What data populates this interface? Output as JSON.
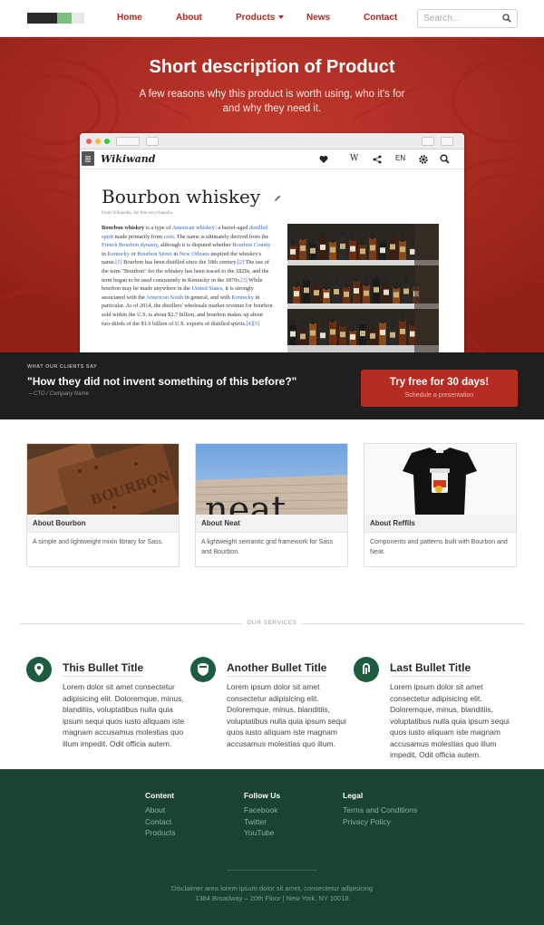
{
  "nav": {
    "links": [
      "Home",
      "About",
      "Products",
      "News",
      "Contact"
    ],
    "search_placeholder": "Search..."
  },
  "hero": {
    "title": "Short description of Product",
    "subtitle": "A few reasons why this product is worth using, who it's for and why they need it."
  },
  "browser": {
    "brand": "Wikiwand",
    "lang": "EN",
    "article_title": "Bourbon whiskey",
    "from_line": "From Wikipedia, the free encyclopedia",
    "body": [
      {
        "t": "Bourbon whiskey",
        "k": "b"
      },
      {
        "t": " is a type of "
      },
      {
        "t": "American whiskey",
        "k": "a"
      },
      {
        "t": ": a barrel-aged "
      },
      {
        "t": "distilled spirit",
        "k": "a"
      },
      {
        "t": " made primarily from "
      },
      {
        "t": "corn",
        "k": "a"
      },
      {
        "t": ". The name is ultimately derived from the "
      },
      {
        "t": "French Bourbon dynasty",
        "k": "a"
      },
      {
        "t": ", although it is disputed whether "
      },
      {
        "t": "Bourbon County",
        "k": "a"
      },
      {
        "t": " in "
      },
      {
        "t": "Kentucky",
        "k": "a"
      },
      {
        "t": " or "
      },
      {
        "t": "Bourbon Street",
        "k": "a"
      },
      {
        "t": " in "
      },
      {
        "t": "New Orleans",
        "k": "a"
      },
      {
        "t": " inspired the whiskey's name."
      },
      {
        "t": "[1]",
        "k": "a"
      },
      {
        "t": " Bourbon has been distilled since the 18th century."
      },
      {
        "t": "[2]",
        "k": "a"
      },
      {
        "t": " The use of the term \"Bourbon\" for the whiskey has been traced to the 1820s, and the term began to be used consistently in Kentucky in the 1870s."
      },
      {
        "t": "[3]",
        "k": "a"
      },
      {
        "t": " While bourbon may be made anywhere in the "
      },
      {
        "t": "United States",
        "k": "a"
      },
      {
        "t": ", it is strongly associated with the "
      },
      {
        "t": "American South",
        "k": "a"
      },
      {
        "t": " in general, and with "
      },
      {
        "t": "Kentucky",
        "k": "a"
      },
      {
        "t": " in particular. As of 2014, the distillers' wholesale market revenue for bourbon sold within the U.S. is about $2.7 billion, and bourbon makes up about two-thirds of the $1.6 billion of U.S. exports of distilled spirits."
      },
      {
        "t": "[4][5]",
        "k": "a"
      }
    ]
  },
  "testimonial": {
    "kicker": "WHAT OUR CLIENTS SAY",
    "quote": "\"How they did not invent something of this before?\"",
    "author": "– CTO / Company Name"
  },
  "cta": {
    "label": "Try free for 30 days!",
    "sub": "Schedule a presentation"
  },
  "cards": [
    {
      "title": "About Bourbon",
      "text": "A simple and lightweight mixin library for Sass."
    },
    {
      "title": "About Neat",
      "text": "A lightweight semantic grid framework for Sass and Bourbon."
    },
    {
      "title": "About Reffils",
      "text": "Components and patterns built with Bourbon and Neat."
    }
  ],
  "services": {
    "label": "OUR SERVICES",
    "items": [
      {
        "title": "This Bullet Title",
        "text": "Lorem dolor sit amet consectetur adipisicing elit. Doloremque, minus, blanditiis, voluptatibus nulla quia ipsum sequi quos iusto aliquam iste magnam accusamus molestias quo illum impedit. Odit officia autem."
      },
      {
        "title": "Another Bullet Title",
        "text": "Lorem ipsum dolor sit amet consectetur adipisicing elit. Doloremque, minus, blanditiis, voluptatibus nulla quia ipsum sequi quos iusto aliquam iste magnam accusamus molestias quo illum."
      },
      {
        "title": "Last Bullet Title",
        "text": "Lorem ipsum dolor sit amet consectetur adipisicing elit. Doloremque, minus, blanditiis, voluptatibus nulla quia ipsum sequi quos iusto aliquam iste magnam accusamus molestias quo illum impedit. Odit officia autem."
      }
    ]
  },
  "footer": {
    "columns": [
      {
        "heading": "Content",
        "links": [
          "About",
          "Contact",
          "Products"
        ]
      },
      {
        "heading": "Follow Us",
        "links": [
          "Facebook",
          "Twitter",
          "YouTube"
        ]
      },
      {
        "heading": "Legal",
        "links": [
          "Terms and Conditions",
          "Privacy Policy"
        ]
      }
    ],
    "disclaimer": "Disclaimer area lorem ipsum dolor sit amet, consectetur adipisicing",
    "address": "1384 Broadway – 20th Floor | New York, NY 10018"
  },
  "colors": {
    "brand_red": "#b52d22",
    "dark_bar": "#1f1f1f",
    "footer_green": "#1a4330",
    "icon_green": "#1d5c3f"
  }
}
